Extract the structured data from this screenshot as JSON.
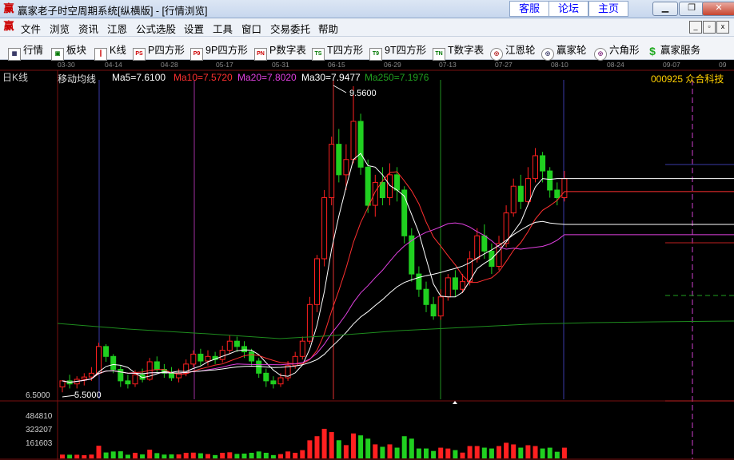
{
  "window": {
    "title": "赢家老子时空周期系统[纵横版] - [行情浏览]",
    "logo_glyph": "赢",
    "links": [
      "客服",
      "论坛",
      "主页"
    ],
    "controls": {
      "minimize": "▁",
      "restore": "❐",
      "close": "✕"
    }
  },
  "menu": {
    "items": [
      "文件",
      "浏览",
      "资讯",
      "江恩",
      "公式选股",
      "设置",
      "工具",
      "窗口",
      "交易委托",
      "帮助"
    ],
    "mdi_controls": [
      "_",
      "▫",
      "x"
    ]
  },
  "toolbar": {
    "items": [
      {
        "label": "行情",
        "icon": "grid-icon",
        "glyph": "▦"
      },
      {
        "label": "板块",
        "icon": "blocks-icon",
        "glyph": "▣"
      },
      {
        "label": "K线",
        "icon": "candles-icon",
        "glyph": "┃"
      },
      {
        "label": "P四方形",
        "icon": "ps-icon",
        "glyph": "PS"
      },
      {
        "label": "9P四方形",
        "icon": "p9-icon",
        "glyph": "P9"
      },
      {
        "label": "P数字表",
        "icon": "pn-icon",
        "glyph": "PN"
      },
      {
        "label": "T四方形",
        "icon": "ts-icon",
        "glyph": "TS"
      },
      {
        "label": "9T四方形",
        "icon": "t9-icon",
        "glyph": "T9"
      },
      {
        "label": "T数字表",
        "icon": "tn-icon",
        "glyph": "TN"
      },
      {
        "label": "江恩轮",
        "icon": "gann-wheel-icon",
        "glyph": "◎"
      },
      {
        "label": "赢家轮",
        "icon": "winner-wheel-icon",
        "glyph": "◎"
      },
      {
        "label": "六角形",
        "icon": "hexagon-icon",
        "glyph": "◎"
      },
      {
        "label": "赢家服务",
        "icon": "dollar-icon",
        "glyph": "$"
      }
    ]
  },
  "ruler": {
    "dates": [
      "03-30",
      "04-14",
      "04-28",
      "05-17",
      "05-31",
      "06-15",
      "06-29",
      "07-13",
      "07-27",
      "08-10",
      "08-24",
      "09-07",
      "09"
    ]
  },
  "chart": {
    "period_label": "日K线",
    "indicator_name": "移动均线",
    "ma": [
      {
        "label": "Ma5=7.6100",
        "color": "#ffffff"
      },
      {
        "label": "Ma10=7.5720",
        "color": "#ff3030"
      },
      {
        "label": "Ma20=7.8020",
        "color": "#e040e0"
      },
      {
        "label": "Ma30=7.9477",
        "color": "#ffffff"
      },
      {
        "label": "Ma250=7.1976",
        "color": "#20a020"
      }
    ],
    "stock": "000925 众合科技",
    "high_label": "9.5600",
    "low_label": "5.5000",
    "axis_low": "6.5000",
    "volume_labels": [
      "484810",
      "323207",
      "161603"
    ],
    "colors": {
      "up": "#ff2020",
      "down": "#20d020",
      "ma5": "#ffffff",
      "ma10": "#ff3030",
      "ma20": "#e040e0",
      "ma30": "#ffffff",
      "ma250": "#1e8c1e"
    }
  },
  "chart_data": {
    "type": "candlestick",
    "title": "000925 众合科技",
    "period": "日K线",
    "price_range": [
      5.5,
      9.56
    ],
    "volume_ticks": [
      161603,
      323207,
      484810
    ],
    "candles": [
      [
        5.62,
        5.7,
        5.7,
        5.55
      ],
      [
        5.7,
        5.66,
        5.78,
        5.6
      ],
      [
        5.66,
        5.72,
        5.76,
        5.6
      ],
      [
        5.72,
        5.75,
        5.8,
        5.64
      ],
      [
        5.75,
        5.8,
        5.88,
        5.7
      ],
      [
        5.8,
        6.15,
        6.2,
        5.78
      ],
      [
        6.15,
        6.02,
        6.18,
        5.95
      ],
      [
        6.02,
        5.85,
        6.05,
        5.8
      ],
      [
        5.85,
        5.7,
        5.9,
        5.62
      ],
      [
        5.7,
        5.66,
        5.78,
        5.6
      ],
      [
        5.66,
        5.78,
        5.84,
        5.62
      ],
      [
        5.78,
        5.72,
        5.86,
        5.68
      ],
      [
        5.72,
        5.95,
        6.0,
        5.7
      ],
      [
        5.95,
        5.85,
        6.02,
        5.8
      ],
      [
        5.85,
        5.8,
        5.92,
        5.74
      ],
      [
        5.8,
        5.74,
        5.88,
        5.7
      ],
      [
        5.74,
        5.8,
        5.86,
        5.68
      ],
      [
        5.8,
        5.92,
        5.98,
        5.76
      ],
      [
        5.92,
        6.05,
        6.1,
        5.88
      ],
      [
        6.05,
        5.96,
        6.12,
        5.9
      ],
      [
        5.96,
        6.02,
        6.1,
        5.9
      ],
      [
        6.02,
        5.98,
        6.08,
        5.92
      ],
      [
        5.98,
        6.1,
        6.16,
        5.94
      ],
      [
        6.1,
        6.22,
        6.3,
        6.05
      ],
      [
        6.22,
        6.15,
        6.28,
        6.08
      ],
      [
        6.15,
        6.08,
        6.22,
        6.0
      ],
      [
        6.08,
        5.96,
        6.12,
        5.9
      ],
      [
        5.96,
        5.8,
        6.0,
        5.74
      ],
      [
        5.8,
        5.7,
        5.86,
        5.62
      ],
      [
        5.7,
        5.66,
        5.76,
        5.6
      ],
      [
        5.66,
        5.74,
        5.8,
        5.62
      ],
      [
        5.74,
        5.9,
        5.96,
        5.7
      ],
      [
        5.9,
        6.02,
        6.08,
        5.86
      ],
      [
        6.02,
        6.22,
        6.28,
        5.98
      ],
      [
        6.22,
        6.7,
        6.8,
        6.18
      ],
      [
        6.7,
        7.3,
        7.35,
        6.6
      ],
      [
        7.3,
        8.1,
        8.2,
        7.2
      ],
      [
        8.1,
        8.8,
        8.9,
        8.0
      ],
      [
        8.8,
        8.4,
        9.0,
        8.3
      ],
      [
        8.4,
        8.6,
        8.8,
        8.2
      ],
      [
        8.6,
        9.1,
        9.56,
        8.55
      ],
      [
        9.1,
        8.5,
        9.2,
        8.4
      ],
      [
        8.5,
        8.0,
        8.6,
        7.9
      ],
      [
        8.0,
        8.3,
        8.4,
        7.85
      ],
      [
        8.3,
        8.1,
        8.5,
        8.0
      ],
      [
        8.1,
        8.4,
        8.55,
        8.0
      ],
      [
        8.4,
        8.2,
        8.5,
        8.05
      ],
      [
        8.2,
        7.6,
        8.25,
        7.5
      ],
      [
        7.6,
        7.1,
        7.7,
        7.0
      ],
      [
        7.1,
        6.9,
        7.2,
        6.8
      ],
      [
        6.9,
        6.7,
        7.0,
        6.6
      ],
      [
        6.7,
        6.55,
        6.8,
        6.5
      ],
      [
        6.55,
        6.8,
        6.9,
        6.5
      ],
      [
        6.8,
        7.05,
        7.1,
        6.75
      ],
      [
        7.05,
        6.9,
        7.15,
        6.8
      ],
      [
        6.9,
        7.0,
        7.1,
        6.85
      ],
      [
        7.0,
        7.3,
        7.4,
        6.95
      ],
      [
        7.3,
        7.6,
        7.7,
        7.25
      ],
      [
        7.6,
        7.4,
        7.75,
        7.3
      ],
      [
        7.4,
        7.2,
        7.5,
        7.1
      ],
      [
        7.2,
        7.5,
        7.6,
        7.15
      ],
      [
        7.5,
        7.9,
        8.0,
        7.45
      ],
      [
        7.9,
        8.25,
        8.35,
        7.85
      ],
      [
        8.25,
        8.05,
        8.4,
        7.95
      ],
      [
        8.05,
        8.35,
        8.5,
        8.0
      ],
      [
        8.35,
        8.65,
        8.75,
        8.3
      ],
      [
        8.65,
        8.45,
        8.7,
        8.3
      ],
      [
        8.45,
        8.2,
        8.5,
        8.1
      ],
      [
        8.2,
        8.1,
        8.3,
        8.0
      ],
      [
        8.1,
        8.35,
        8.45,
        8.05
      ]
    ]
  }
}
